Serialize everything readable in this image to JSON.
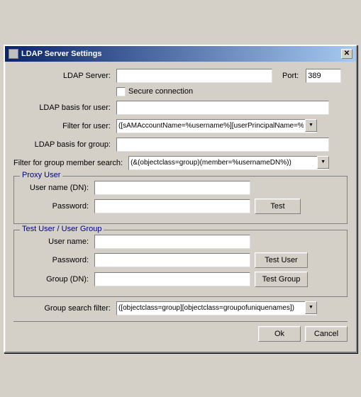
{
  "window": {
    "title": "LDAP Server Settings",
    "close_label": "✕"
  },
  "form": {
    "ldap_server_label": "LDAP Server:",
    "ldap_server_value": "",
    "port_label": "Port:",
    "port_value": "389",
    "secure_label": "Secure connection",
    "ldap_basis_user_label": "LDAP basis for user:",
    "ldap_basis_user_value": "",
    "filter_user_label": "Filter for user:",
    "filter_user_value": "([sAMAccountName=%username%][userPrincipalName=%",
    "ldap_basis_group_label": "LDAP basis for group:",
    "ldap_basis_group_value": "",
    "filter_group_label": "Filter for group member search:",
    "filter_group_value": "(&(objectclass=group)(member=%usernameDN%))",
    "proxy_user_section": "Proxy User",
    "proxy_username_label": "User name (DN):",
    "proxy_username_value": "",
    "proxy_password_label": "Password:",
    "proxy_password_value": "",
    "test_button": "Test",
    "test_user_section": "Test User / User Group",
    "test_username_label": "User name:",
    "test_username_value": "",
    "test_password_label": "Password:",
    "test_password_value": "",
    "test_group_label": "Group (DN):",
    "test_group_value": "",
    "test_user_button": "Test User",
    "test_group_button": "Test Group",
    "group_search_label": "Group search filter:",
    "group_search_value": "([objectclass=group][objectclass=groupofuniquenames])",
    "ok_button": "Ok",
    "cancel_button": "Cancel"
  }
}
